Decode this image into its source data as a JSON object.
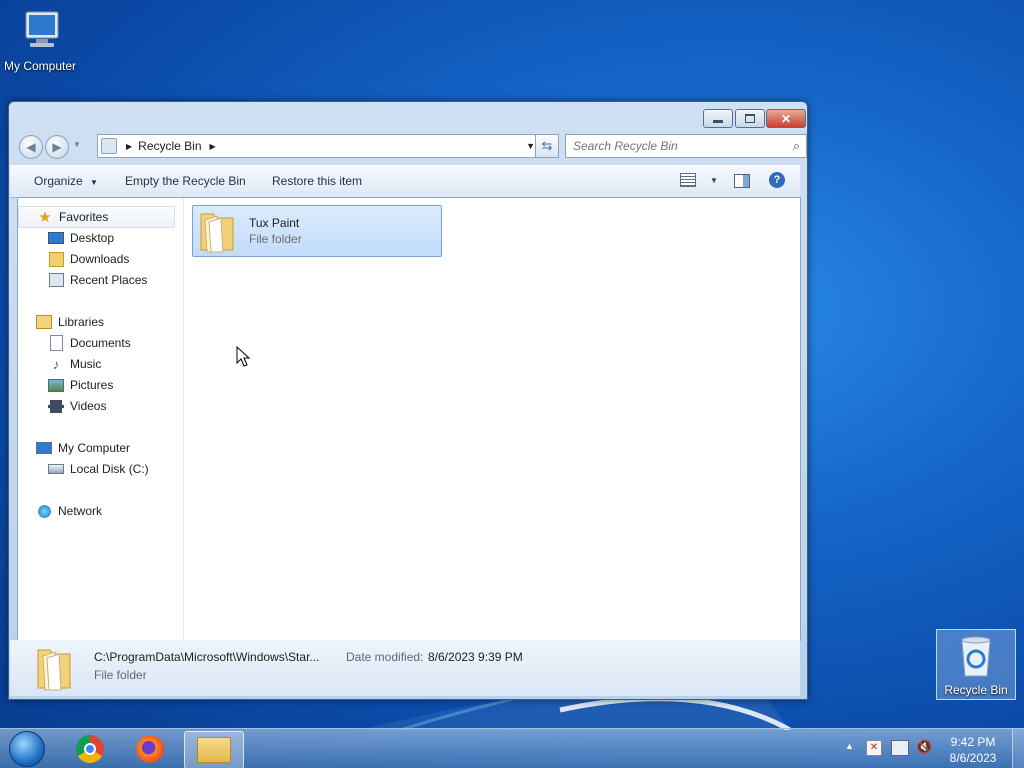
{
  "desktop": {
    "my_computer_label": "My Computer",
    "recycle_bin_label": "Recycle Bin"
  },
  "window": {
    "address_segment": "Recycle Bin",
    "search_placeholder": "Search Recycle Bin",
    "toolbar": {
      "organize": "Organize",
      "empty": "Empty the Recycle Bin",
      "restore": "Restore this item"
    },
    "nav": {
      "favorites": "Favorites",
      "desktop": "Desktop",
      "downloads": "Downloads",
      "recent_places": "Recent Places",
      "libraries": "Libraries",
      "documents": "Documents",
      "music": "Music",
      "pictures": "Pictures",
      "videos": "Videos",
      "my_computer": "My Computer",
      "local_disk": "Local Disk (C:)",
      "network": "Network"
    },
    "items": [
      {
        "name": "Tux Paint",
        "type": "File folder"
      }
    ],
    "details": {
      "path": "C:\\ProgramData\\Microsoft\\Windows\\Star...",
      "date_label": "Date modified:",
      "date_value": "8/6/2023 9:39 PM",
      "type": "File folder"
    }
  },
  "taskbar": {
    "time": "9:42 PM",
    "date": "8/6/2023"
  },
  "colors": {
    "desktop_blue": "#1565c8",
    "selection": "#cce4fb",
    "close_red": "#c7432b"
  }
}
